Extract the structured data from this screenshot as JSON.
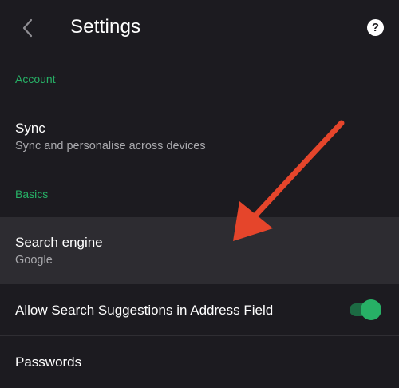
{
  "header": {
    "back_icon": "chevron-left-icon",
    "title": "Settings",
    "help_icon": "help-circle-icon",
    "help_glyph": "?"
  },
  "sections": {
    "account": "Account",
    "basics": "Basics"
  },
  "sync": {
    "title": "Sync",
    "subtitle": "Sync and personalise across devices"
  },
  "search_engine": {
    "title": "Search engine",
    "value": "Google"
  },
  "search_suggestions": {
    "title": "Allow Search Suggestions in Address Field",
    "enabled": true
  },
  "passwords": {
    "title": "Passwords"
  },
  "colors": {
    "background": "#1c1b20",
    "accent": "#27b066",
    "highlight_row": "#2d2c31",
    "annotation_arrow": "#e5452b"
  }
}
